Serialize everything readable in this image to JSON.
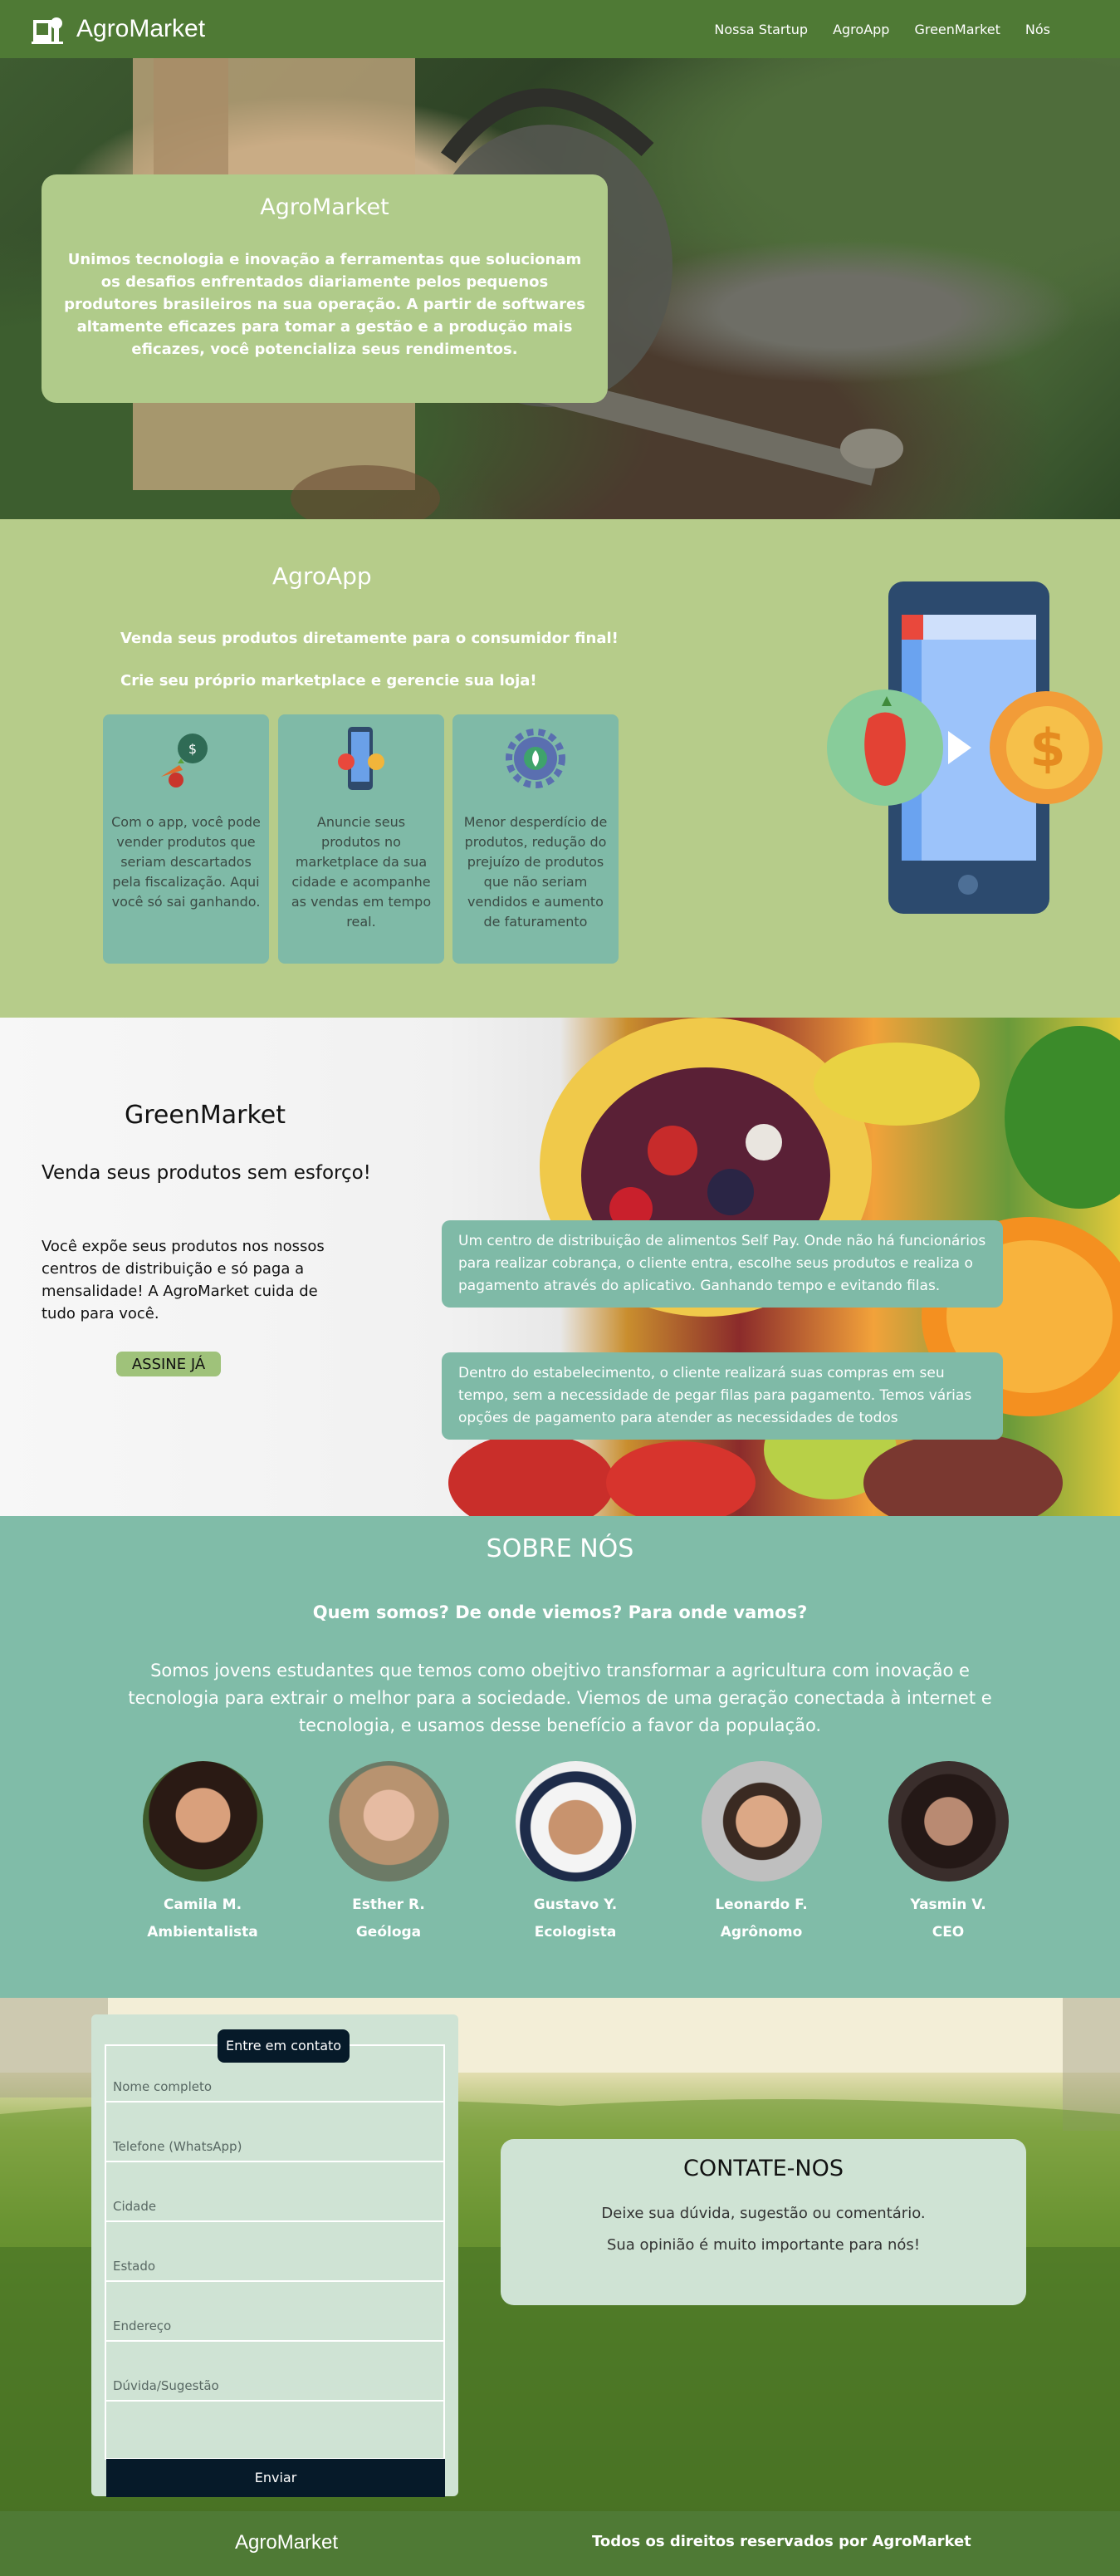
{
  "nav": {
    "brand": "AgroMarket",
    "links": [
      "Nossa Startup",
      "AgroApp",
      "GreenMarket",
      "Nós"
    ]
  },
  "hero": {
    "title": "AgroMarket",
    "text": "Unimos tecnologia e inovação a ferramentas que solucionam os desafios enfrentados diariamente pelos pequenos produtores brasileiros na sua operação. A partir de softwares altamente eficazes para tomar a gestão e a produção mais eficazes, você potencializa seus rendimentos."
  },
  "agroapp": {
    "title": "AgroApp",
    "line1": "Venda seus produtos diretamente para o consumidor final!",
    "line2": "Crie seu próprio marketplace e gerencie sua loja!",
    "features": [
      {
        "icon": "money-bag-vegetables-icon",
        "text": "Com o app, você pode vender produtos que seriam descartados pela fiscalização. Aqui você só sai ganhando."
      },
      {
        "icon": "phone-marketplace-icon",
        "text": "Anuncie seus produtos no marketplace da sua cidade e acompanhe as vendas em tempo real."
      },
      {
        "icon": "recycle-gear-icon",
        "text": "Menor desperdício de produtos, redução do prejuízo de produtos que não seriam vendidos e aumento de faturamento"
      }
    ]
  },
  "greenmarket": {
    "title": "GreenMarket",
    "subtitle": "Venda seus produtos sem esforço!",
    "description": "Você expõe seus produtos nos nossos centros de distribuição e só paga a mensalidade! A AgroMarket cuida de tudo para você.",
    "button": "ASSINE JÁ",
    "box1": "Um centro de distribuição de alimentos Self Pay. Onde não há funcionários para realizar cobrança, o cliente entra, escolhe seus produtos e realiza o pagamento através do aplicativo. Ganhando tempo e evitando filas.",
    "box2": "Dentro do estabelecimento, o cliente realizará suas compras em seu tempo, sem a necessidade de pegar filas para pagamento. Temos várias opções de pagamento para atender as necessidades de todos"
  },
  "about": {
    "title": "SOBRE NÓS",
    "question": "Quem somos? De onde viemos? Para onde vamos?",
    "text": "Somos jovens estudantes que temos como obejtivo transformar a agricultura com inovação e tecnologia para extrair o melhor para a sociedade. Viemos de uma geração conectada à internet e tecnologia, e usamos desse benefício a favor da população.",
    "members": [
      {
        "name": "Camila M.",
        "role": "Ambientalista"
      },
      {
        "name": "Esther R.",
        "role": "Geóloga"
      },
      {
        "name": "Gustavo Y.",
        "role": "Ecologista"
      },
      {
        "name": "Leonardo F.",
        "role": "Agrônomo"
      },
      {
        "name": "Yasmin V.",
        "role": "CEO"
      }
    ]
  },
  "contact": {
    "form_title": "Entre em contato",
    "fields": [
      "Nome completo",
      "Telefone (WhatsApp)",
      "Cidade",
      "Estado",
      "Endereço",
      "Dúvida/Sugestão"
    ],
    "submit": "Enviar",
    "box_title": "CONTATE-NOS",
    "box_line1": "Deixe sua dúvida, sugestão ou comentário.",
    "box_line2": "Sua opinião é muito importante para nós!"
  },
  "footer": {
    "brand": "AgroMarket",
    "copyright": "Todos os direitos reservados por AgroMarket"
  },
  "colors": {
    "nav_green": "#4f7a35",
    "light_green": "#b6cc8a",
    "teal": "#7fbaa7",
    "navy": "#061a29",
    "mint": "#cfe3d4"
  }
}
